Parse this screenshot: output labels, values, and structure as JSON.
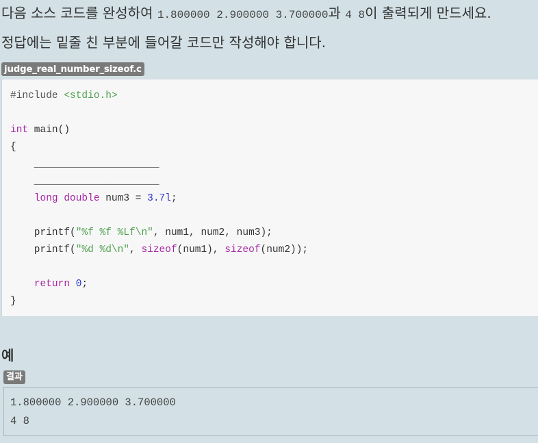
{
  "intro": {
    "line1_prefix": "다음 소스 코드를 완성하여 ",
    "line1_output1": "1.800000 2.900000 3.700000",
    "line1_mid": "과 ",
    "line1_output2": "4 8",
    "line1_suffix": "이 출력되게 만드세요.",
    "line2": "정답에는 밑줄 친 부분에 들어갈 코드만 작성해야 합니다."
  },
  "file": {
    "name": "judge_real_number_sizeof.c"
  },
  "code": {
    "l1_pp": "#include ",
    "l1_hdr": "<stdio.h>",
    "l3_kw": "int",
    "l3_rest": " main()",
    "l4": "{",
    "blank1": "    _____________________",
    "blank2": "    _____________________",
    "l7_indent": "    ",
    "l7_kw": "long double",
    "l7_mid": " num3 = ",
    "l7_num": "3.7l",
    "l7_end": ";",
    "l9_a": "    printf(",
    "l9_str": "\"%f %f %Lf\\n\"",
    "l9_b": ", num1, num2, num3);",
    "l10_a": "    printf(",
    "l10_str": "\"%d %d\\n\"",
    "l10_b": ", ",
    "l10_kw1": "sizeof",
    "l10_c": "(num1), ",
    "l10_kw2": "sizeof",
    "l10_d": "(num2));",
    "l12_indent": "    ",
    "l12_kw": "return",
    "l12_sp": " ",
    "l12_num": "0",
    "l12_end": ";",
    "l13": "}"
  },
  "example": {
    "title": "예",
    "result_label": "결과",
    "output_line1": "1.800000 2.900000 3.700000",
    "output_line2": "4 8"
  }
}
